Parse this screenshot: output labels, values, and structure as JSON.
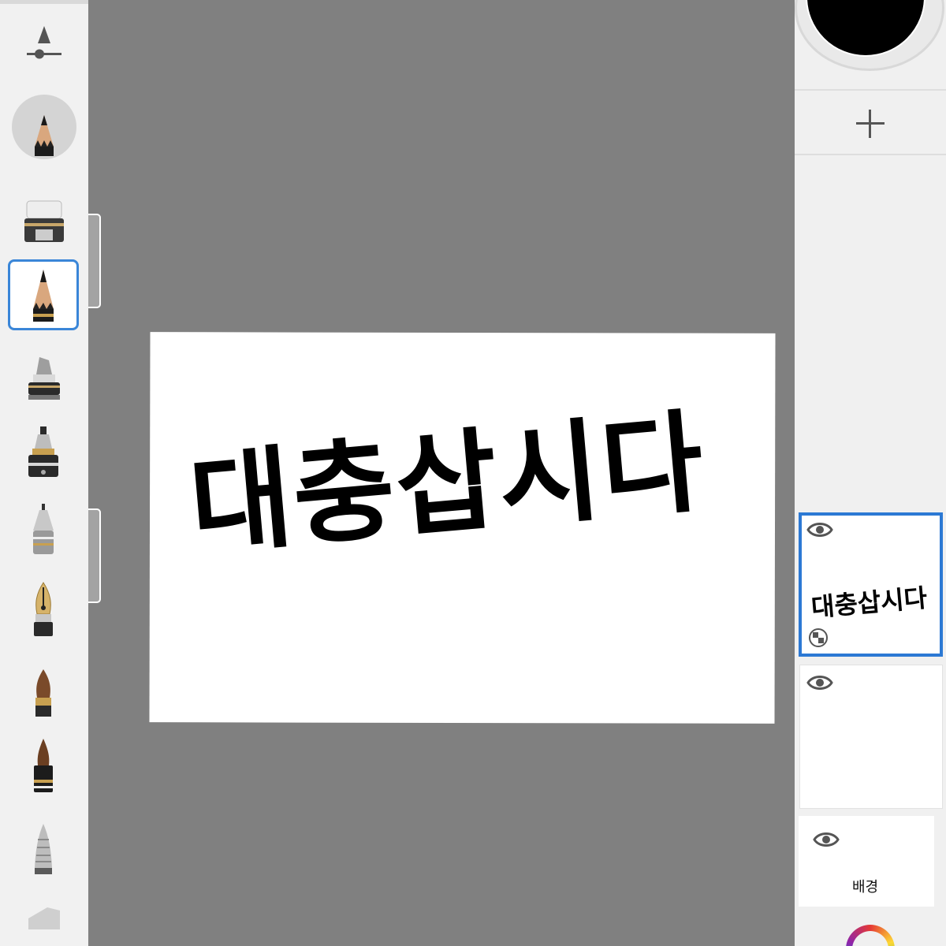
{
  "canvas": {
    "text": "대충삽시다"
  },
  "toolbar": {
    "brushes": [
      {
        "icon": "eraser-icon"
      },
      {
        "icon": "pencil-icon",
        "selected": true
      },
      {
        "icon": "marker-icon"
      },
      {
        "icon": "fountain-pen-icon"
      },
      {
        "icon": "technical-pen-icon"
      },
      {
        "icon": "calligraphy-nib-icon"
      },
      {
        "icon": "paint-brush-icon"
      },
      {
        "icon": "ink-brush-icon"
      },
      {
        "icon": "airbrush-icon"
      },
      {
        "icon": "chisel-marker-icon"
      }
    ]
  },
  "color": {
    "current": "#000000",
    "previous": "#a6a6a6"
  },
  "layers": [
    {
      "thumbnail_text": "대충삽시다",
      "active": true
    },
    {
      "thumbnail_text": ""
    },
    {
      "name": "배경"
    }
  ],
  "colors": {
    "accent": "#2c79d4",
    "workspace": "#808080"
  }
}
